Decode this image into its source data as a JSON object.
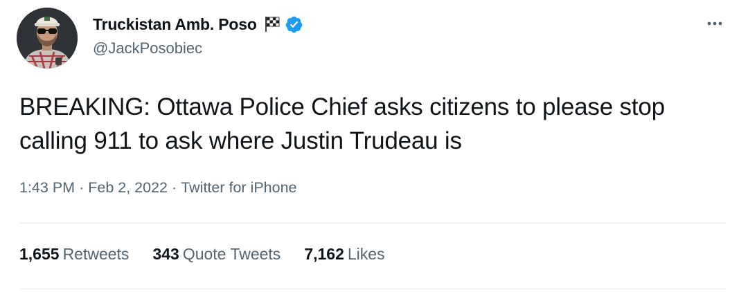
{
  "author": {
    "name": "Truckistan Amb. Poso",
    "handle": "@JackPosobiec",
    "verified": true,
    "name_emoji": "checkered-flag-icon",
    "avatar": "avatar-photo"
  },
  "tweet": {
    "text": "BREAKING: Ottawa Police Chief asks citizens to please stop calling 911 to ask where Justin Trudeau is",
    "time": "1:43 PM",
    "date": "Feb 2, 2022",
    "source": "Twitter for iPhone",
    "separator": "·"
  },
  "stats": {
    "retweets": {
      "count": "1,655",
      "label": "Retweets"
    },
    "quote_tweets": {
      "count": "343",
      "label": "Quote Tweets"
    },
    "likes": {
      "count": "7,162",
      "label": "Likes"
    }
  },
  "menu": {
    "icon": "more-horizontal-icon"
  },
  "colors": {
    "text_primary": "#0f1419",
    "text_secondary": "#536471",
    "verified_blue": "#1d9bf0",
    "divider": "#e6ecf0"
  }
}
